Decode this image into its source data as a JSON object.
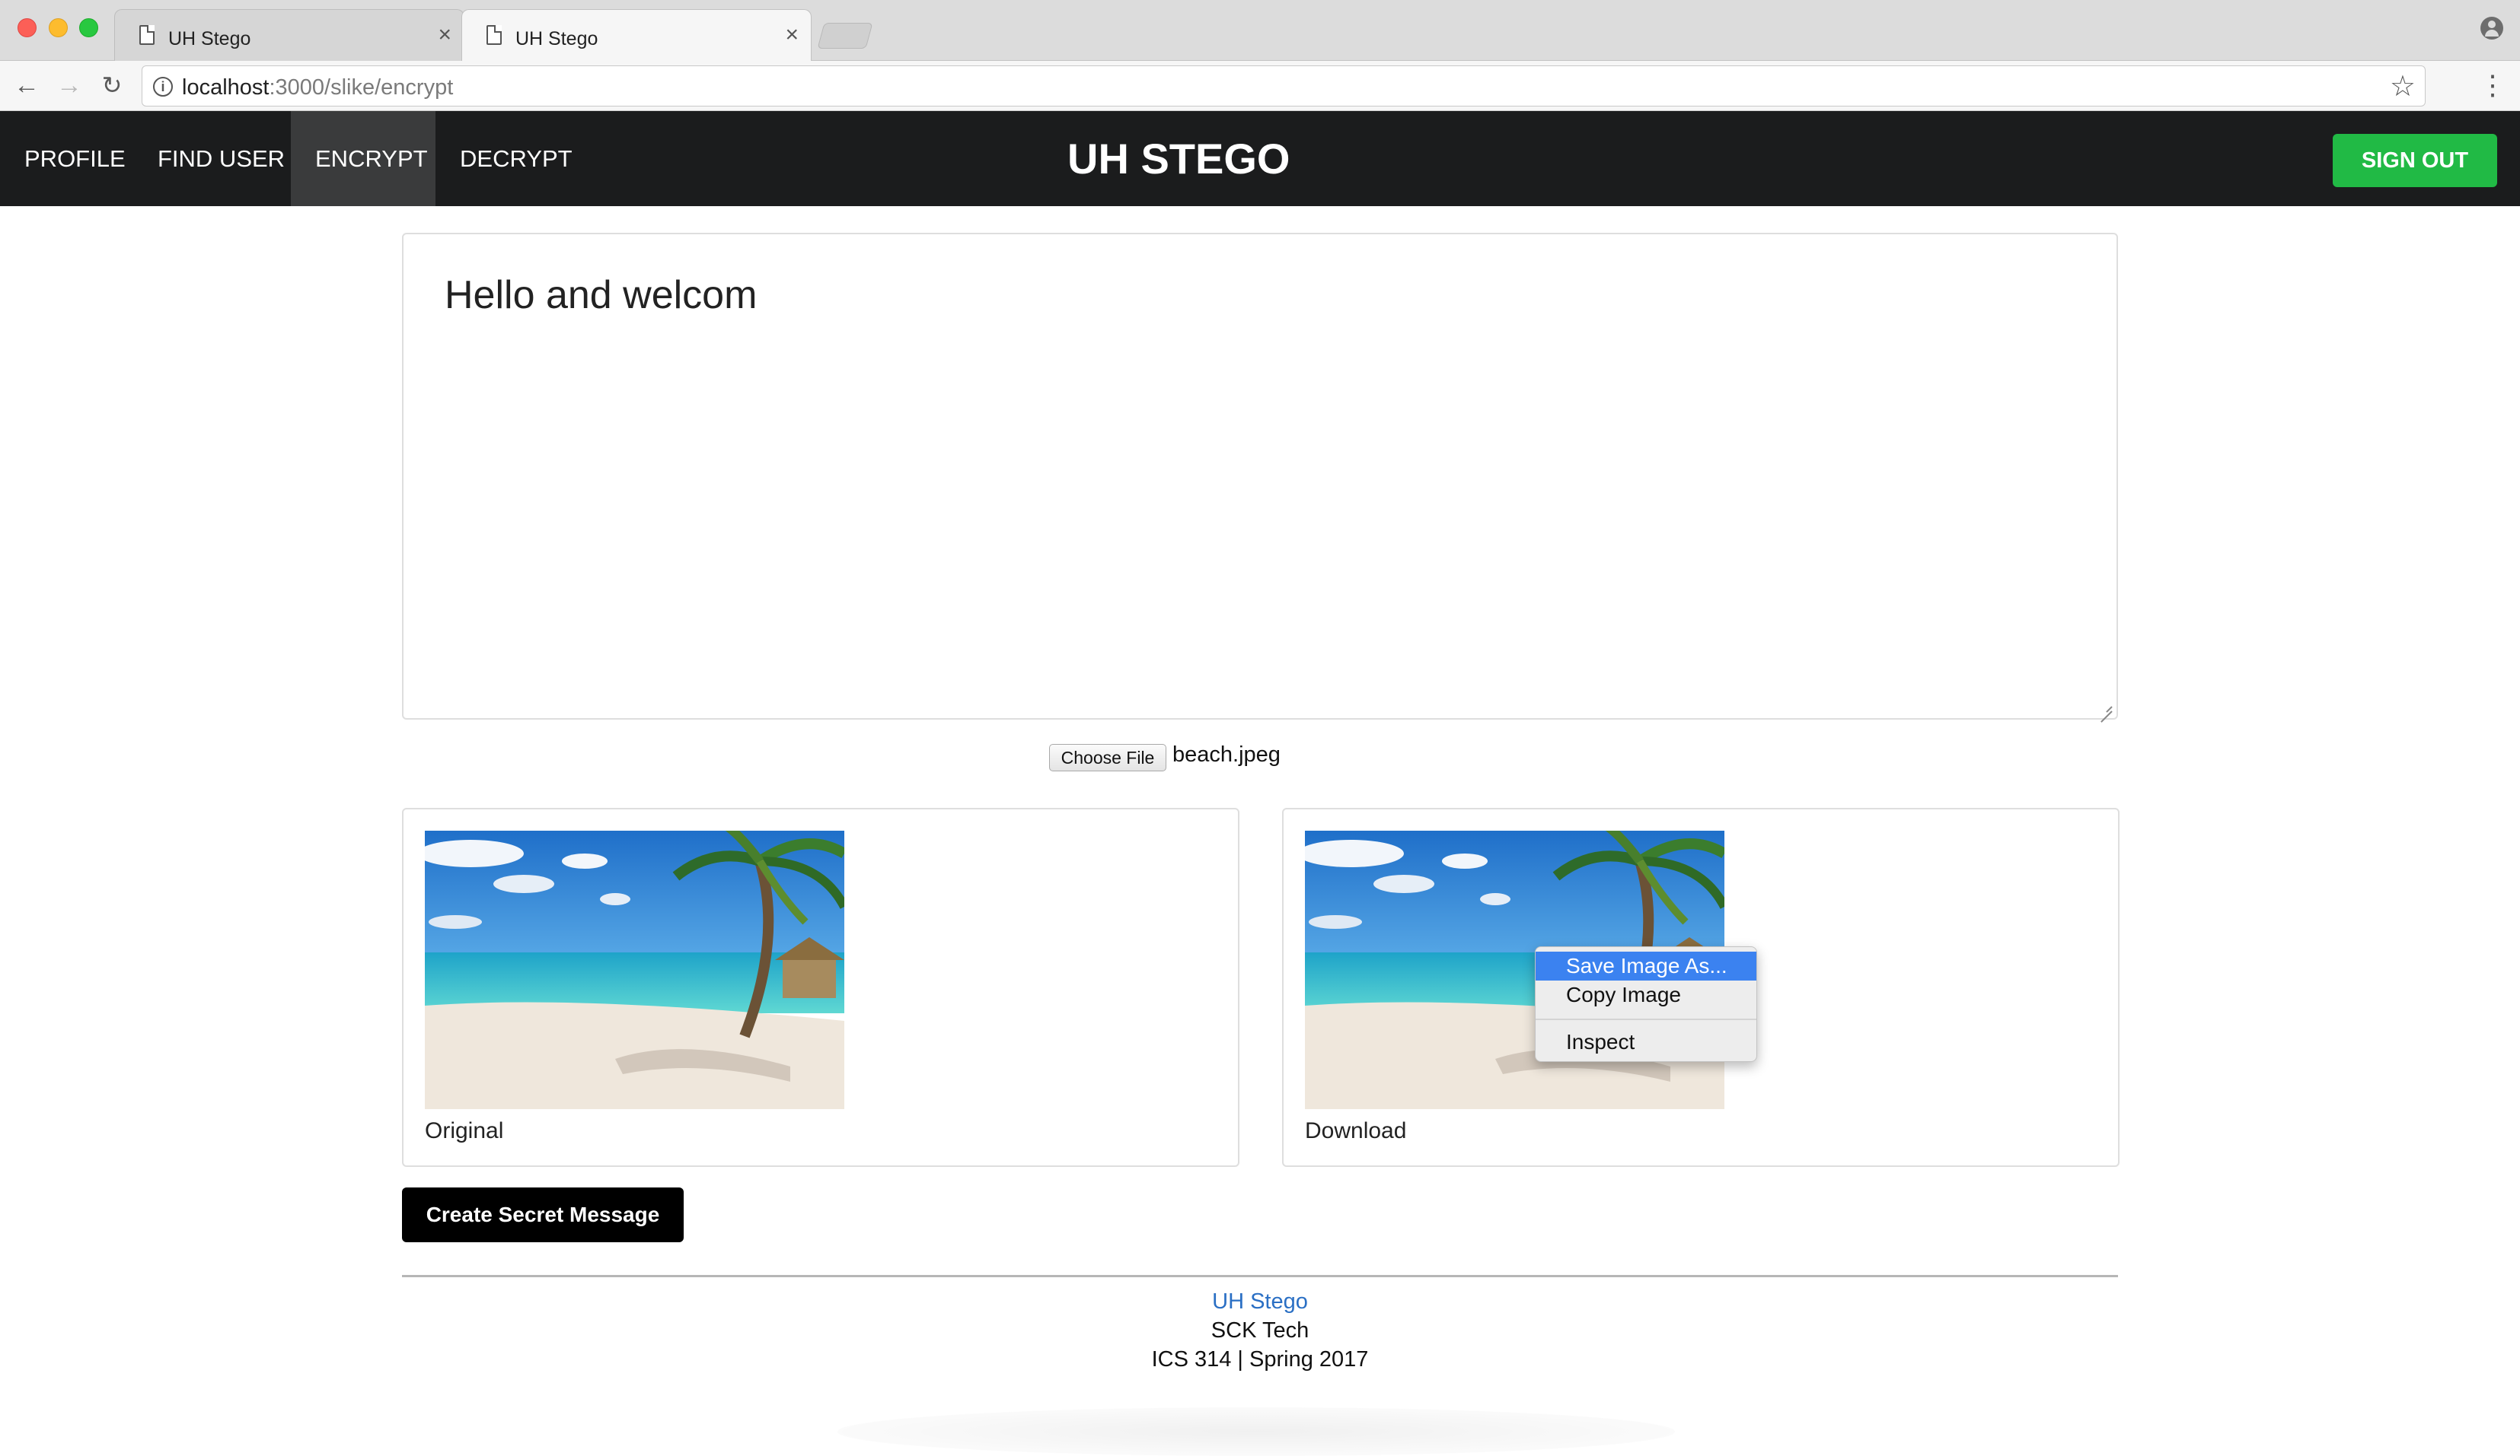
{
  "browser": {
    "tabs": [
      {
        "title": "UH Stego",
        "active": false
      },
      {
        "title": "UH Stego",
        "active": true
      }
    ],
    "url_host": "localhost",
    "url_path": ":3000/slike/encrypt"
  },
  "nav": {
    "items": [
      "PROFILE",
      "FIND USER",
      "ENCRYPT",
      "DECRYPT"
    ],
    "active": "ENCRYPT",
    "brand": "UH STEGO",
    "signout_label": "SIGN OUT",
    "signout_color": "#21ba45",
    "bar_color": "#1b1c1d"
  },
  "editor": {
    "message_value": "Hello and welcom"
  },
  "file_input": {
    "button_label": "Choose File",
    "file_name": "beach.jpeg"
  },
  "images": {
    "original_caption": "Original",
    "download_caption": "Download"
  },
  "context_menu": {
    "items": [
      "Save Image As...",
      "Copy Image",
      "Inspect"
    ],
    "highlighted": "Save Image As..."
  },
  "actions": {
    "create_label": "Create Secret Message"
  },
  "footer": {
    "link": "UH Stego",
    "team": "SCK Tech",
    "course": "ICS 314 | Spring 2017"
  }
}
